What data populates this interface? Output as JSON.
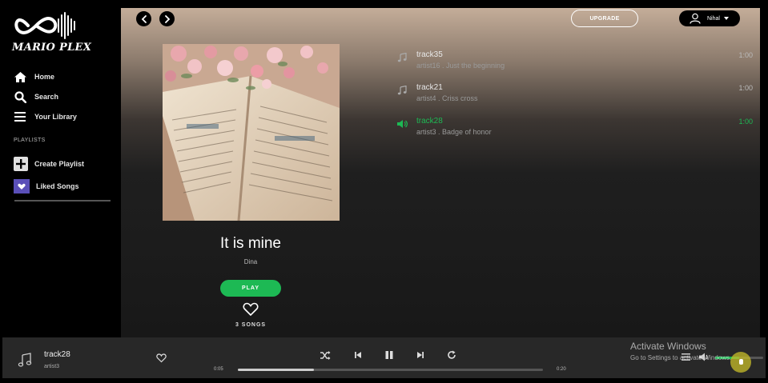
{
  "brand": {
    "name": "MARIO PLEX"
  },
  "sidebar": {
    "nav": [
      {
        "label": "Home",
        "icon": "home-icon"
      },
      {
        "label": "Search",
        "icon": "search-icon"
      },
      {
        "label": "Your Library",
        "icon": "library-icon"
      }
    ],
    "playlists_header": "PLAYLISTS",
    "actions": [
      {
        "label": "Create Playlist",
        "icon": "plus-icon"
      },
      {
        "label": "Liked Songs",
        "icon": "heart-icon"
      }
    ]
  },
  "header": {
    "upgrade_label": "UPGRADE",
    "user_name": "Nihal"
  },
  "album": {
    "title": "It is mine",
    "artist": "Dina",
    "play_label": "PLAY",
    "song_count": "3 SONGS"
  },
  "tracks": [
    {
      "name": "track35",
      "subtitle": "artist16 .  Just the beginning",
      "duration": "1:00",
      "icon": "music-note-icon",
      "active": false
    },
    {
      "name": "track21",
      "subtitle": "artist4 .  Criss cross",
      "duration": "1:00",
      "icon": "music-note-icon",
      "active": false
    },
    {
      "name": "track28",
      "subtitle": "artist3 .  Badge of honor",
      "duration": "1:00",
      "icon": "speaker-icon",
      "active": true
    }
  ],
  "player": {
    "title": "track28",
    "artist": "artist3",
    "elapsed": "0:05",
    "total": "0:20",
    "progress": 0.25,
    "volume": 0.5
  },
  "watermark": {
    "line1": "Activate Windows",
    "line2": "Go to Settings to activate Windows."
  },
  "colors": {
    "accent": "#1db954",
    "sidebar_bg": "#000000",
    "player_bg": "#282828"
  }
}
